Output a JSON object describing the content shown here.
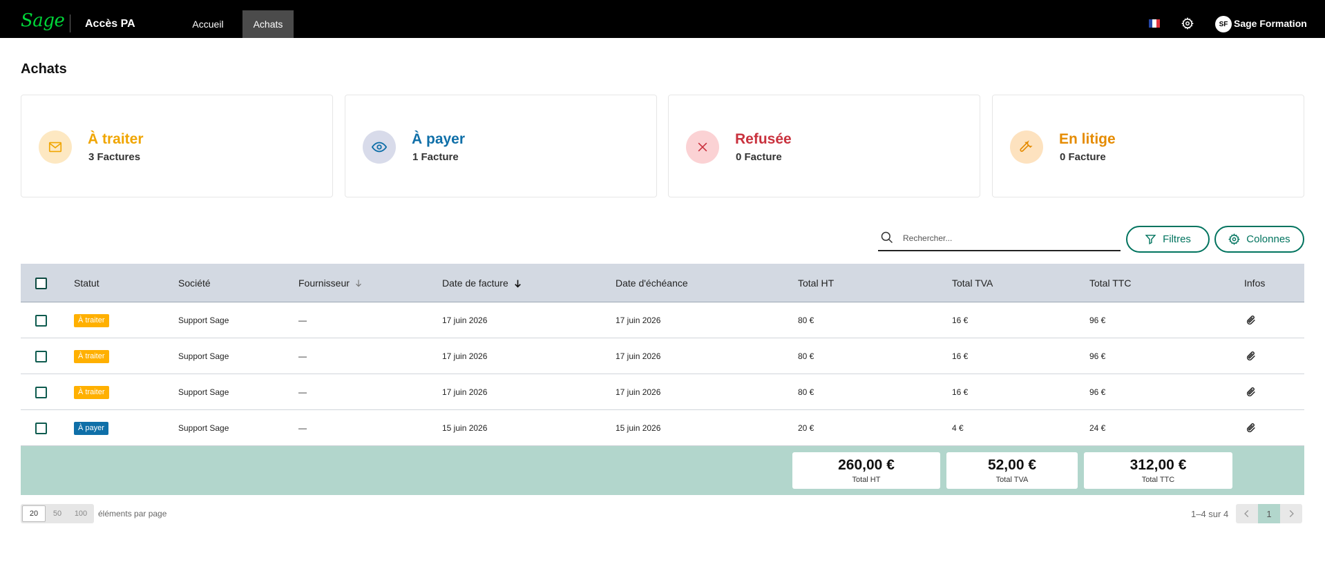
{
  "header": {
    "logo": "Sage",
    "app_title": "Accès PA",
    "nav": [
      {
        "label": "Accueil",
        "active": false
      },
      {
        "label": "Achats",
        "active": true
      }
    ],
    "flag": "flag-fr-icon",
    "user_initials": "SF",
    "user_name": "Sage Formation"
  },
  "page": {
    "title": "Achats"
  },
  "cards": [
    {
      "title": "À traiter",
      "subtitle": "3 Factures",
      "color": "#f0a500",
      "icon": "mail-icon"
    },
    {
      "title": "À payer",
      "subtitle": "1 Facture",
      "color": "#0f6fa8",
      "icon": "eye-icon"
    },
    {
      "title": "Refusée",
      "subtitle": "0 Facture",
      "color": "#c9323e",
      "icon": "close-icon"
    },
    {
      "title": "En litige",
      "subtitle": "0 Facture",
      "color": "#e58b00",
      "icon": "wrench-icon"
    }
  ],
  "toolbar": {
    "search_placeholder": "Rechercher...",
    "filters_label": "Filtres",
    "columns_label": "Colonnes"
  },
  "table": {
    "columns": [
      "Statut",
      "Société",
      "Fournisseur",
      "Date de facture",
      "Date d'échéance",
      "Total HT",
      "Total TVA",
      "Total TTC",
      "Infos"
    ],
    "rows": [
      {
        "statut": "À traiter",
        "societe": "Support Sage",
        "fournisseur": "—",
        "date_facture": "17 juin 2026",
        "date_echeance": "17 juin 2026",
        "total_ht": "80 €",
        "total_tva": "16 €",
        "total_ttc": "96 €"
      },
      {
        "statut": "À traiter",
        "societe": "Support Sage",
        "fournisseur": "—",
        "date_facture": "17 juin 2026",
        "date_echeance": "17 juin 2026",
        "total_ht": "80 €",
        "total_tva": "16 €",
        "total_ttc": "96 €"
      },
      {
        "statut": "À traiter",
        "societe": "Support Sage",
        "fournisseur": "—",
        "date_facture": "17 juin 2026",
        "date_echeance": "17 juin 2026",
        "total_ht": "80 €",
        "total_tva": "16 €",
        "total_ttc": "96 €"
      },
      {
        "statut": "À payer",
        "societe": "Support Sage",
        "fournisseur": "—",
        "date_facture": "15 juin 2026",
        "date_echeance": "15 juin 2026",
        "total_ht": "20 €",
        "total_tva": "4 €",
        "total_ttc": "24 €"
      }
    ]
  },
  "totals": [
    {
      "amount": "260,00 €",
      "label": "Total HT"
    },
    {
      "amount": "52,00 €",
      "label": "Total TVA"
    },
    {
      "amount": "312,00 €",
      "label": "Total TTC"
    }
  ],
  "pagination": {
    "page_sizes": [
      "20",
      "50",
      "100"
    ],
    "selected_page_size": "20",
    "page_size_label": "éléments par page",
    "range_label": "1–4 sur 4",
    "current_page": "1"
  },
  "colors": {
    "accent": "#00735e",
    "brand_green": "#00d639",
    "header_bg": "#000000",
    "table_header_bg": "#d3d9e2",
    "totals_bg": "#b2d6cc"
  }
}
